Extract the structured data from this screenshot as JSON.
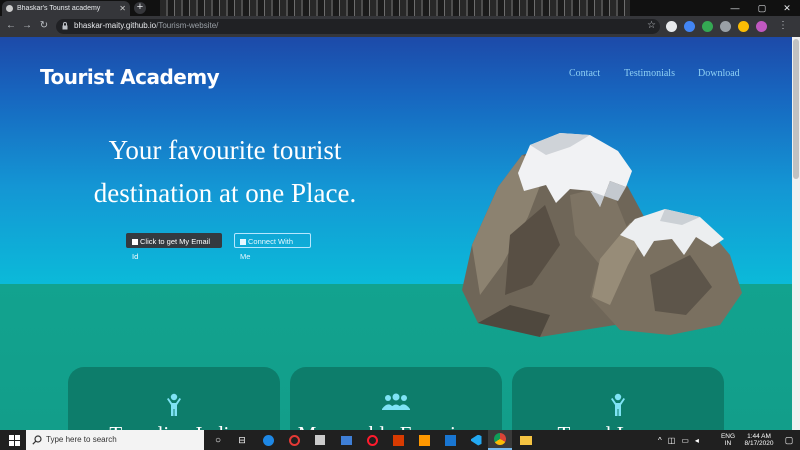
{
  "browser": {
    "tab_title": "Bhaskar's Tourist academy",
    "url_host": "bhaskar-maity.github.io",
    "url_path": "/Tourism-website/"
  },
  "site": {
    "brand": "Tourist Academy",
    "nav": [
      "Contact",
      "Testimonials",
      "Download"
    ],
    "hero_line1": "Your favourite tourist",
    "hero_line2": "destination at one Place.",
    "btn_email": "Click to get My Email Id",
    "btn_connect": "Connect With Me",
    "cards": [
      {
        "title": "Traveling India",
        "icon": "person-icon"
      },
      {
        "title": "Memorable Experience",
        "icon": "users-icon"
      },
      {
        "title": "Travel Legacy",
        "icon": "person-icon"
      }
    ]
  },
  "taskbar": {
    "search_placeholder": "Type here to search",
    "lang": "ENG",
    "region": "IN",
    "time": "1:44 AM",
    "date": "8/17/2020"
  },
  "colors": {
    "hero_top": "#1d4aa9",
    "hero_bottom": "#0bbad9",
    "ground": "#129e8a",
    "card": "#0d7d6b",
    "nav_link": "#8fd0f4"
  }
}
